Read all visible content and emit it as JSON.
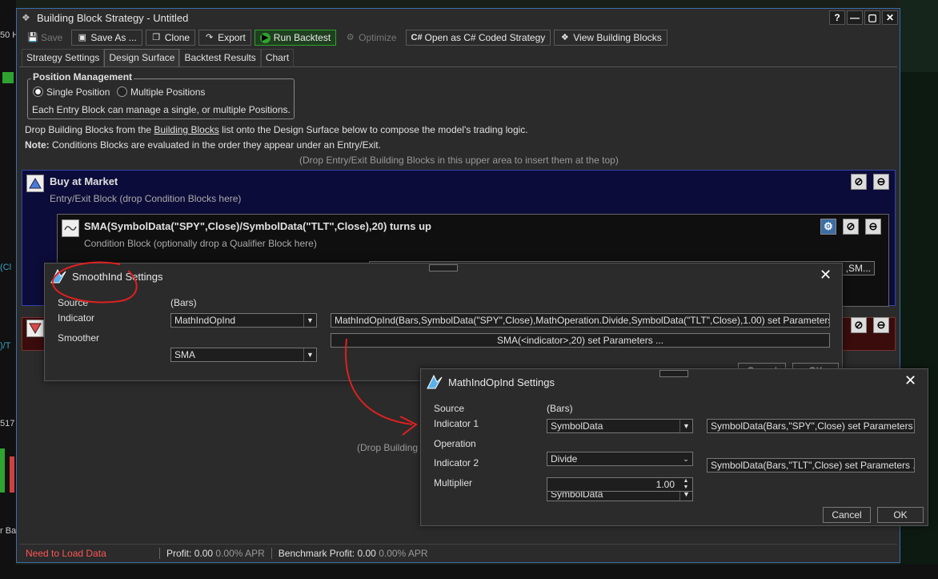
{
  "window": {
    "title": "Building Block Strategy - Untitled",
    "controls": [
      "?",
      "—",
      "▢",
      "✕"
    ]
  },
  "toolbar": {
    "save": "Save",
    "save_as": "Save As ...",
    "clone": "Clone",
    "export": "Export",
    "run_backtest": "Run Backtest",
    "optimize": "Optimize",
    "open_csharp": "Open as C# Coded Strategy",
    "view_blocks": "View Building Blocks"
  },
  "tabs": [
    "Strategy Settings",
    "Design Surface",
    "Backtest Results",
    "Chart"
  ],
  "position_management": {
    "legend": "Position Management",
    "single": "Single Position",
    "multiple": "Multiple Positions",
    "note": "Each Entry Block can manage a single, or multiple Positions."
  },
  "info": {
    "drop_prefix": "Drop Building Blocks from the ",
    "drop_link": "Building Blocks",
    "drop_suffix": " list onto the Design Surface below to compose the model's trading logic.",
    "note_label": "Note:",
    "note_text": " Conditions Blocks are evaluated in the order they appear under an Entry/Exit.",
    "upper_hint": "(Drop Entry/Exit Building Blocks in this upper area to insert them at the top)",
    "lower_hint": "(Drop Building"
  },
  "entry_block": {
    "title": "Buy at Market",
    "subtitle": "Entry/Exit Block (drop Condition Blocks here)"
  },
  "condition_block": {
    "title": "SMA(SymbolData(\"SPY\",Close)/SymbolData(\"TLT\",Close),20) turns up",
    "subtitle": "Condition Block (optionally drop a Qualifier Block here)",
    "param_tail": ",SM..."
  },
  "smooth_dialog": {
    "title": "SmoothInd Settings",
    "source_label": "Source",
    "source_value": "(Bars)",
    "indicator_label": "Indicator",
    "indicator_value": "MathIndOpInd",
    "indicator_params": "MathIndOpInd(Bars,SymbolData(\"SPY\",Close),MathOperation.Divide,SymbolData(\"TLT\",Close),1.00) set Parameters ...",
    "smoother_label": "Smoother",
    "smoother_value": "SMA",
    "smoother_params": "SMA(<indicator>,20) set Parameters ...",
    "cancel": "Cancel",
    "ok": "OK"
  },
  "mathop_dialog": {
    "title": "MathIndOpInd Settings",
    "source_label": "Source",
    "source_value": "(Bars)",
    "ind1_label": "Indicator 1",
    "ind1_value": "SymbolData",
    "ind1_params": "SymbolData(Bars,\"SPY\",Close) set Parameters ...",
    "op_label": "Operation",
    "op_value": "Divide",
    "ind2_label": "Indicator 2",
    "ind2_value": "SymbolData",
    "ind2_params": "SymbolData(Bars,\"TLT\",Close) set Parameters ...",
    "mult_label": "Multiplier",
    "mult_value": "1.00",
    "cancel": "Cancel",
    "ok": "OK"
  },
  "status": {
    "load": "Need to Load Data",
    "profit_label": "Profit:",
    "profit_value": "0.00",
    "profit_apr": "0.00% APR",
    "bench_label": "Benchmark Profit:",
    "bench_value": "0.00",
    "bench_apr": "0.00% APR"
  },
  "bg_fragments": {
    "left_top": "50 H",
    "left_mid1": "(Cl",
    "left_mid2": ")/T",
    "left_num": "517",
    "left_bottom": "r Ba"
  },
  "colors": {
    "accent_green": "#2fa32f",
    "status_red": "#ff5555",
    "annotation_red": "#e02020",
    "entry_bg": "#0c0c3a",
    "exit_bg": "#3a0c0c"
  }
}
